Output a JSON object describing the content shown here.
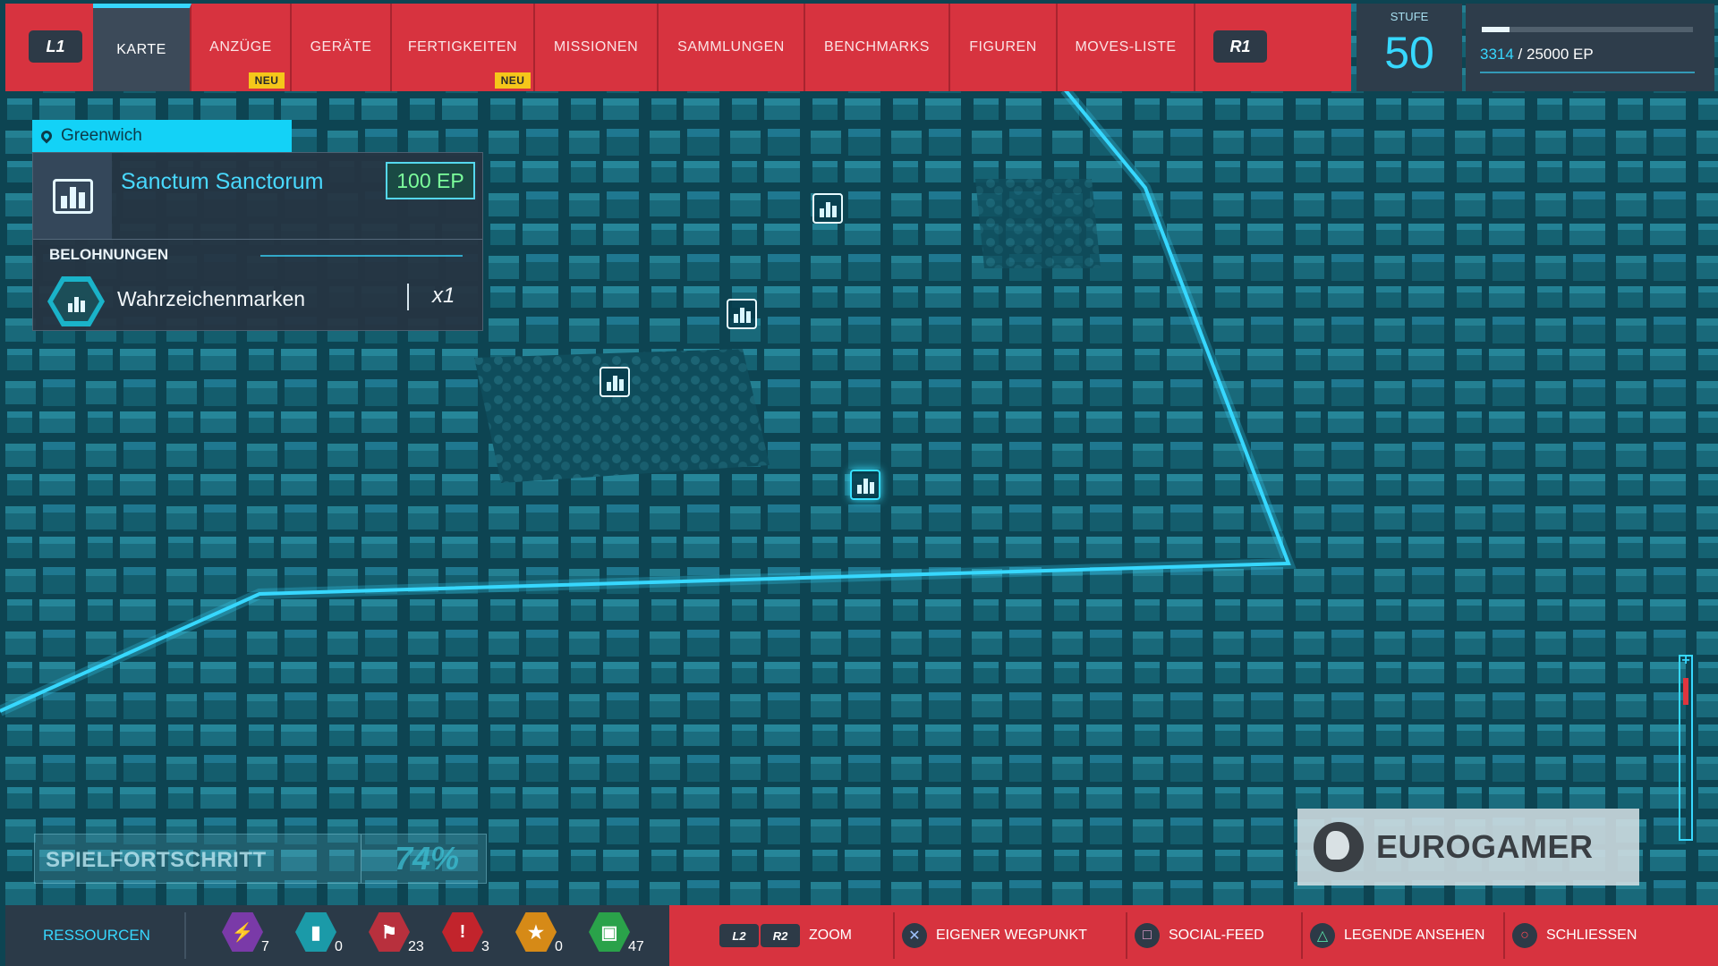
{
  "top_nav": {
    "left_button": "L1",
    "right_button": "R1",
    "tabs": [
      {
        "label": "KARTE",
        "badge": ""
      },
      {
        "label": "ANZÜGE",
        "badge": "NEU"
      },
      {
        "label": "GERÄTE",
        "badge": ""
      },
      {
        "label": "FERTIGKEITEN",
        "badge": "NEU"
      },
      {
        "label": "MISSIONEN",
        "badge": ""
      },
      {
        "label": "SAMMLUNGEN",
        "badge": ""
      },
      {
        "label": "BENCHMARKS",
        "badge": ""
      },
      {
        "label": "FIGUREN",
        "badge": ""
      },
      {
        "label": "MOVES-LISTE",
        "badge": ""
      }
    ],
    "active_tab": "KARTE"
  },
  "level": {
    "label": "STUFE",
    "value": "50"
  },
  "experience": {
    "current": "3314",
    "separator": " / ",
    "max": "25000 EP",
    "fraction": 0.1326
  },
  "location": {
    "district": "Greenwich"
  },
  "selected": {
    "name": "Sanctum Sanctorum",
    "xp_reward": "100 EP",
    "rewards_heading": "BELOHNUNGEN",
    "reward_name": "Wahrzeichenmarken",
    "reward_qty": "x1"
  },
  "progress": {
    "label": "SPIELFORTSCHRITT",
    "value": "74%"
  },
  "watermark": {
    "text": "EUROGAMER"
  },
  "resources": {
    "title": "RESSOURCEN",
    "items": [
      {
        "icon": "research-token-icon",
        "count": "7",
        "color": "#7a3aa8"
      },
      {
        "icon": "landmark-token-icon",
        "count": "0",
        "color": "#1b9aa8"
      },
      {
        "icon": "base-token-icon",
        "count": "23",
        "color": "#b8303d"
      },
      {
        "icon": "crime-token-icon",
        "count": "3",
        "color": "#c2242c"
      },
      {
        "icon": "challenge-token-icon",
        "count": "0",
        "color": "#d68a17"
      },
      {
        "icon": "backpack-token-icon",
        "count": "47",
        "color": "#2aa24a"
      }
    ]
  },
  "actions": [
    {
      "buttons": [
        "L2",
        "R2"
      ],
      "label": "ZOOM"
    },
    {
      "buttons": [
        "✕"
      ],
      "label": "EIGENER WEGPUNKT"
    },
    {
      "buttons": [
        "□"
      ],
      "label": "SOCIAL-FEED"
    },
    {
      "buttons": [
        "△"
      ],
      "label": "LEGENDE ANSEHEN"
    },
    {
      "buttons": [
        "○"
      ],
      "label": "SCHLIESSEN"
    }
  ],
  "colors": {
    "accent": "#37d8ff",
    "nav_red": "#d7333f",
    "panel": "#263442",
    "map_base": "#0d4252"
  }
}
